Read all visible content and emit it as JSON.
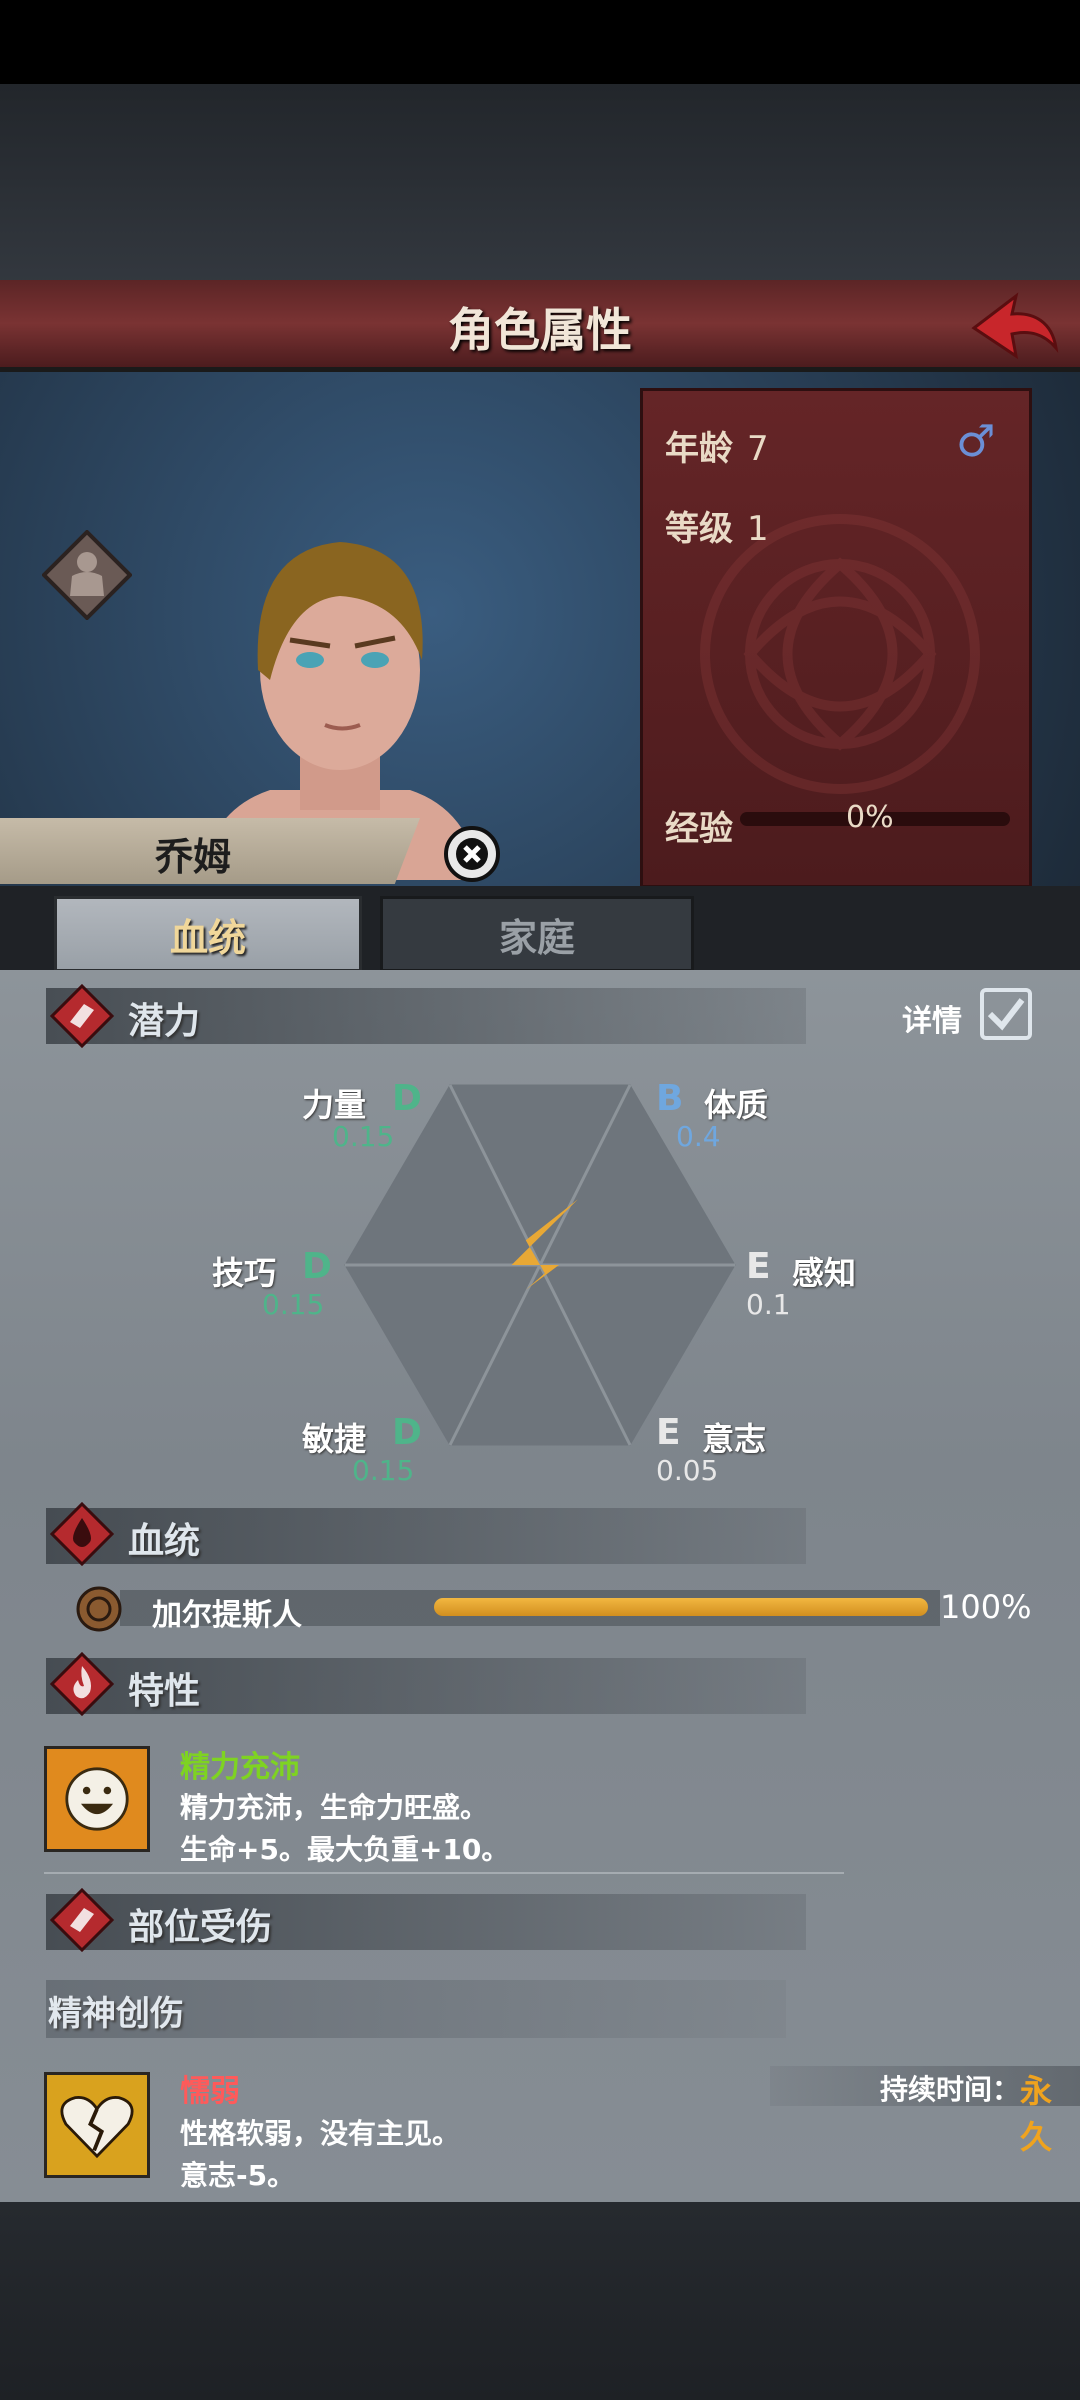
{
  "header": {
    "title": "角色属性"
  },
  "character": {
    "name": "乔姆"
  },
  "info": {
    "age_label": "年龄",
    "age_value": "7",
    "level_label": "等级",
    "level_value": "1",
    "exp_label": "经验",
    "exp_value": "0%",
    "exp_fraction": 0.0,
    "gender_icon": "male-icon"
  },
  "tabs": [
    {
      "label": "血统",
      "active": true
    },
    {
      "label": "家庭",
      "active": false
    }
  ],
  "potential": {
    "title": "潜力",
    "detail_label": "详情",
    "detail_checked": true,
    "stats": [
      {
        "name": "力量",
        "grade": "D",
        "value": "0.15"
      },
      {
        "name": "体质",
        "grade": "B",
        "value": "0.4"
      },
      {
        "name": "技巧",
        "grade": "D",
        "value": "0.15"
      },
      {
        "name": "感知",
        "grade": "E",
        "value": "0.1"
      },
      {
        "name": "敏捷",
        "grade": "D",
        "value": "0.15"
      },
      {
        "name": "意志",
        "grade": "E",
        "value": "0.05"
      }
    ],
    "grade_colors": {
      "B": "#6fa7df",
      "D": "#4fb48a",
      "E": "#e8e8e8"
    }
  },
  "bloodline": {
    "title": "血统",
    "entries": [
      {
        "name": "加尔提斯人",
        "percent": "100%",
        "fraction": 1.0
      }
    ]
  },
  "traits": {
    "title": "特性",
    "items": [
      {
        "name": "精力充沛",
        "desc1": "精力充沛，生命力旺盛。",
        "desc2": "生命+5。最大负重+10。",
        "color": "#7ed321"
      }
    ]
  },
  "injuries": {
    "title": "部位受伤",
    "subsection": "精神创伤",
    "items": [
      {
        "name": "懦弱",
        "desc1": "性格软弱，没有主见。",
        "desc2": "意志-5。",
        "color": "#ff5a5a",
        "duration_label": "持续时间：",
        "duration_value": "永久"
      }
    ]
  }
}
